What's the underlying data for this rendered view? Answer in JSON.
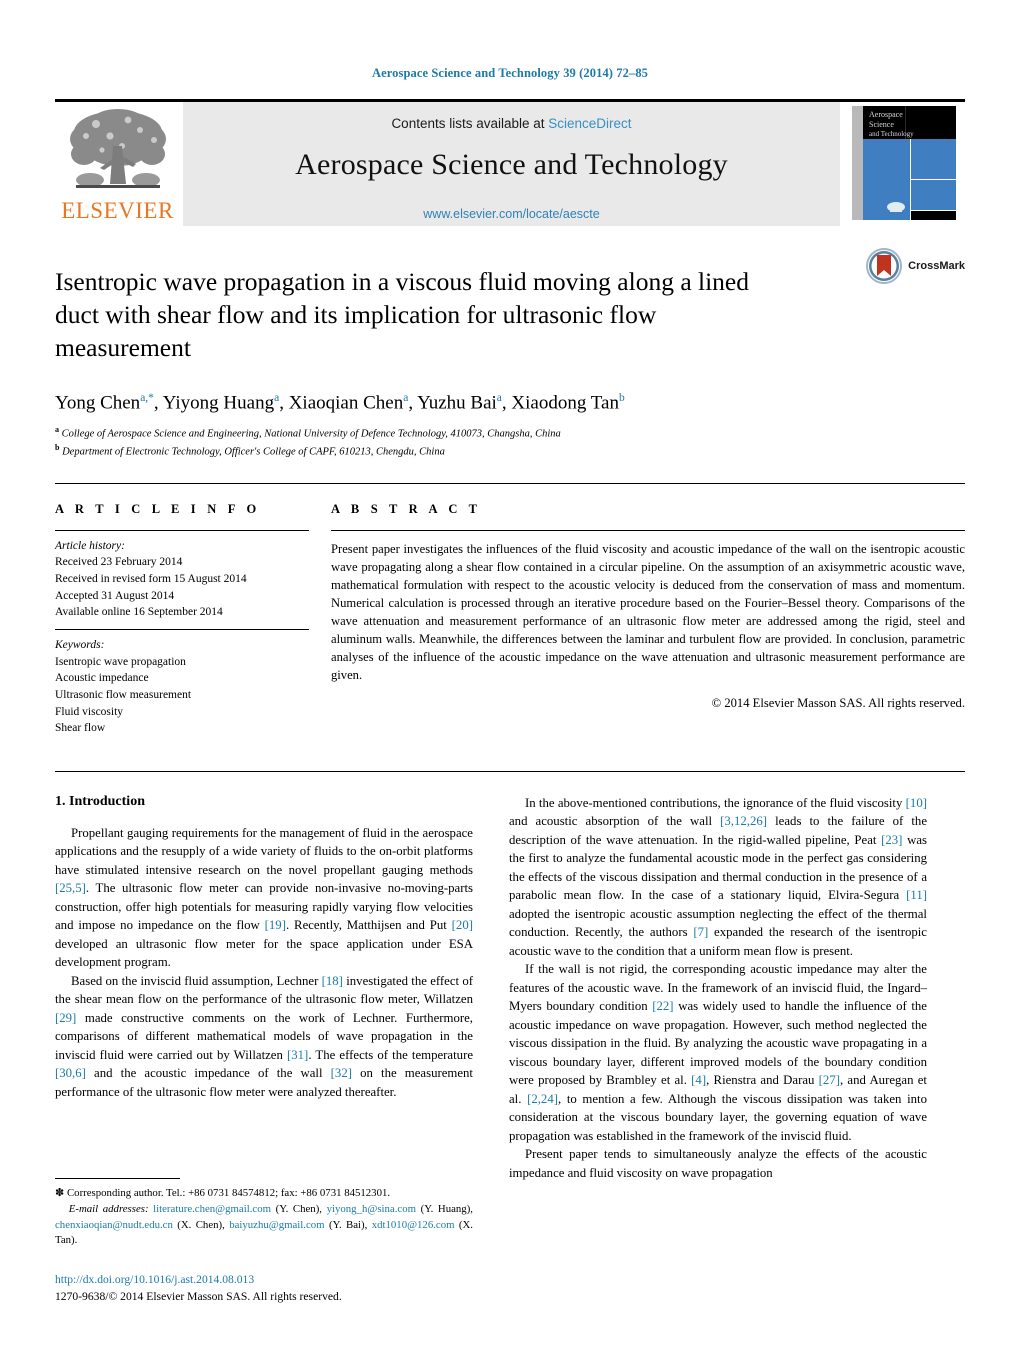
{
  "running_head": "Aerospace Science and Technology 39 (2014) 72–85",
  "masthead": {
    "publisher_name": "ELSEVIER",
    "contents_prefix": "Contents lists available at ",
    "contents_link": "ScienceDirect",
    "journal_title": "Aerospace Science and Technology",
    "journal_url": "www.elsevier.com/locate/aescte",
    "cover_title_lines": [
      "Aerospace",
      "Science",
      "and",
      "Technology"
    ]
  },
  "article": {
    "title": "Isentropic wave propagation in a viscous fluid moving along a lined duct with shear flow and its implication for ultrasonic flow measurement",
    "crossmark_label": "CrossMark",
    "authors": [
      {
        "name": "Yong Chen",
        "marks": "a,*"
      },
      {
        "name": "Yiyong Huang",
        "marks": "a"
      },
      {
        "name": "Xiaoqian Chen",
        "marks": "a"
      },
      {
        "name": "Yuzhu Bai",
        "marks": "a"
      },
      {
        "name": "Xiaodong Tan",
        "marks": "b"
      }
    ],
    "affiliations": [
      {
        "mark": "a",
        "text": "College of Aerospace Science and Engineering, National University of Defence Technology, 410073, Changsha, China"
      },
      {
        "mark": "b",
        "text": "Department of Electronic Technology, Officer's College of CAPF, 610213, Chengdu, China"
      }
    ]
  },
  "article_info": {
    "heading": "A R T I C L E   I N F O",
    "history_label": "Article history:",
    "history": [
      "Received 23 February 2014",
      "Received in revised form 15 August 2014",
      "Accepted 31 August 2014",
      "Available online 16 September 2014"
    ],
    "keywords_label": "Keywords:",
    "keywords": [
      "Isentropic wave propagation",
      "Acoustic impedance",
      "Ultrasonic flow measurement",
      "Fluid viscosity",
      "Shear flow"
    ]
  },
  "abstract": {
    "heading": "A B S T R A C T",
    "text": "Present paper investigates the influences of the fluid viscosity and acoustic impedance of the wall on the isentropic acoustic wave propagating along a shear flow contained in a circular pipeline. On the assumption of an axisymmetric acoustic wave, mathematical formulation with respect to the acoustic velocity is deduced from the conservation of mass and momentum. Numerical calculation is processed through an iterative procedure based on the Fourier–Bessel theory. Comparisons of the wave attenuation and measurement performance of an ultrasonic flow meter are addressed among the rigid, steel and aluminum walls. Meanwhile, the differences between the laminar and turbulent flow are provided. In conclusion, parametric analyses of the influence of the acoustic impedance on the wave attenuation and ultrasonic measurement performance are given.",
    "copyright": "© 2014 Elsevier Masson SAS. All rights reserved."
  },
  "body": {
    "section_title": "1. Introduction",
    "left_paragraphs": [
      "Propellant gauging requirements for the management of fluid in the aerospace applications and the resupply of a wide variety of fluids to the on-orbit platforms have stimulated intensive research on the novel propellant gauging methods [25,5]. The ultrasonic flow meter can provide non-invasive no-moving-parts construction, offer high potentials for measuring rapidly varying flow velocities and impose no impedance on the flow [19]. Recently, Matthijsen and Put [20] developed an ultrasonic flow meter for the space application under ESA development program.",
      "Based on the inviscid fluid assumption, Lechner [18] investigated the effect of the shear mean flow on the performance of the ultrasonic flow meter, Willatzen [29] made constructive comments on the work of Lechner. Furthermore, comparisons of different mathematical models of wave propagation in the inviscid fluid were carried out by Willatzen [31]. The effects of the temperature [30,6] and the acoustic impedance of the wall [32] on the measurement performance of the ultrasonic flow meter were analyzed thereafter."
    ],
    "right_paragraphs": [
      "In the above-mentioned contributions, the ignorance of the fluid viscosity [10] and acoustic absorption of the wall [3,12,26] leads to the failure of the description of the wave attenuation. In the rigid-walled pipeline, Peat [23] was the first to analyze the fundamental acoustic mode in the perfect gas considering the effects of the viscous dissipation and thermal conduction in the presence of a parabolic mean flow. In the case of a stationary liquid, Elvira-Segura [11] adopted the isentropic acoustic assumption neglecting the effect of the thermal conduction. Recently, the authors [7] expanded the research of the isentropic acoustic wave to the condition that a uniform mean flow is present.",
      "If the wall is not rigid, the corresponding acoustic impedance may alter the features of the acoustic wave. In the framework of an inviscid fluid, the Ingard–Myers boundary condition [22] was widely used to handle the influence of the acoustic impedance on wave propagation. However, such method neglected the viscous dissipation in the fluid. By analyzing the acoustic wave propagating in a viscous boundary layer, different improved models of the boundary condition were proposed by Brambley et al. [4], Rienstra and Darau [27], and Auregan et al. [2,24], to mention a few. Although the viscous dissipation was taken into consideration at the viscous boundary layer, the governing equation of wave propagation was established in the framework of the inviscid fluid.",
      "Present paper tends to simultaneously analyze the effects of the acoustic impedance and fluid viscosity on wave propagation"
    ]
  },
  "footnote": {
    "marker": "✽",
    "corresponding": "Corresponding author. Tel.: +86 0731 84574812; fax: +86 0731 84512301.",
    "email_label": "E-mail addresses:",
    "emails": [
      {
        "address": "literature.chen@gmail.com",
        "owner": "(Y. Chen),"
      },
      {
        "address": "yiyong_h@sina.com",
        "owner": "(Y. Huang),"
      },
      {
        "address": "chenxiaoqian@nudt.edu.cn",
        "owner": "(X. Chen),"
      },
      {
        "address": "baiyuzhu@gmail.com",
        "owner": "(Y. Bai),"
      },
      {
        "address": "xdt1010@126.com",
        "owner": "(X. Tan)."
      }
    ]
  },
  "doi_block": {
    "doi": "http://dx.doi.org/10.1016/j.ast.2014.08.013",
    "issn_line": "1270-9638/© 2014 Elsevier Masson SAS. All rights reserved."
  },
  "colors": {
    "link": "#1c7aa8",
    "elsevier_orange": "#E87722",
    "banner_bg": "#e9e9e9",
    "cover_blue": "#3f7fc1"
  }
}
